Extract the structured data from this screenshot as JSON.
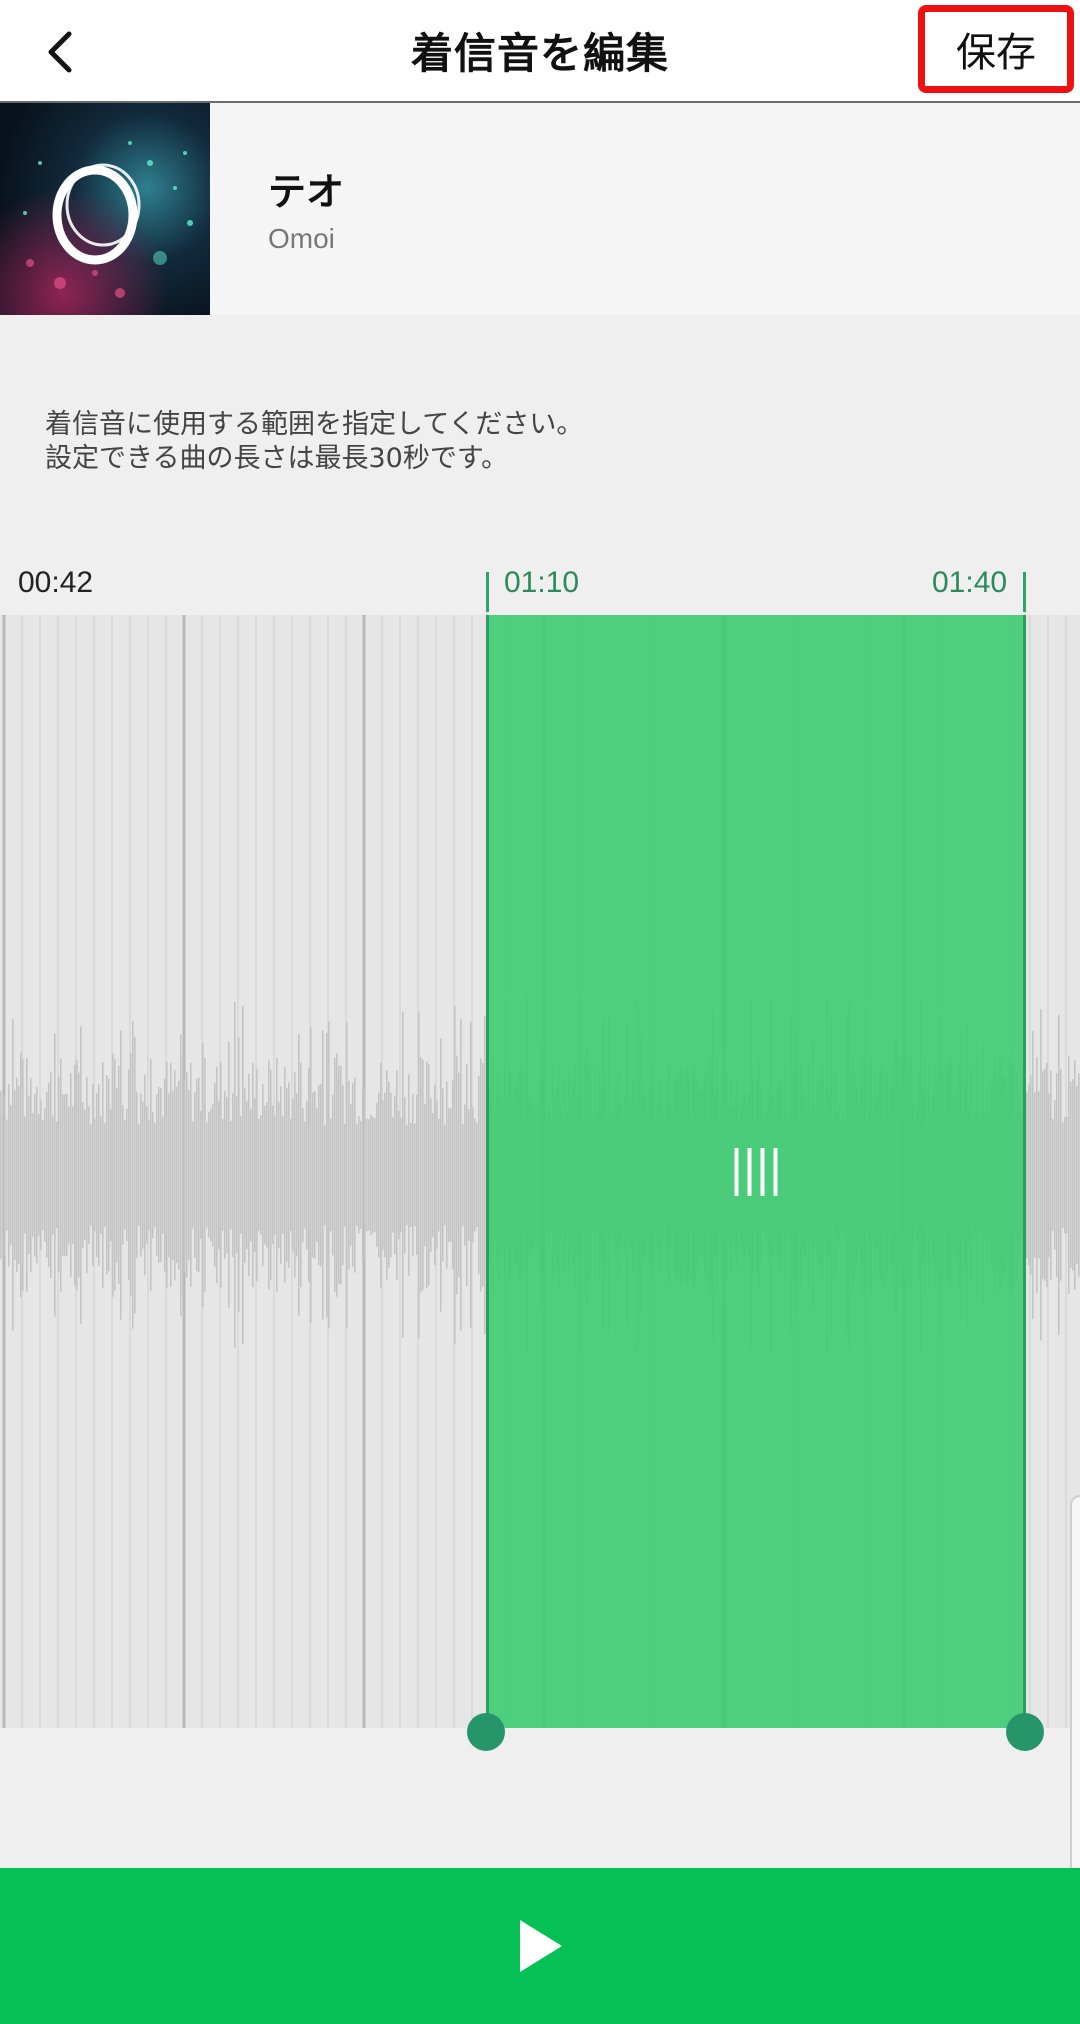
{
  "header": {
    "title": "着信音を編集",
    "save_label": "保存",
    "back_icon": "chevron-left-icon"
  },
  "track": {
    "title": "テオ",
    "artist": "Omoi",
    "art_colors": {
      "background": "#0b1a2a",
      "accent": "#3dd6b8",
      "glow": "#c0306a"
    }
  },
  "instructions": {
    "line1": "着信音に使用する範囲を指定してください。",
    "line2": "設定できる曲の長さは最長30秒です。"
  },
  "timeline": {
    "visible_start": "00:42",
    "selection_start": "01:10",
    "selection_end": "01:40",
    "max_length_seconds": 30
  },
  "colors": {
    "accent_green": "#05c055",
    "selection_green": "#38cc6e",
    "handle_green": "#26956a",
    "highlight_red": "#ee1111",
    "waveform_gray": "#c4c4c4"
  },
  "player": {
    "play_icon": "play-icon"
  }
}
